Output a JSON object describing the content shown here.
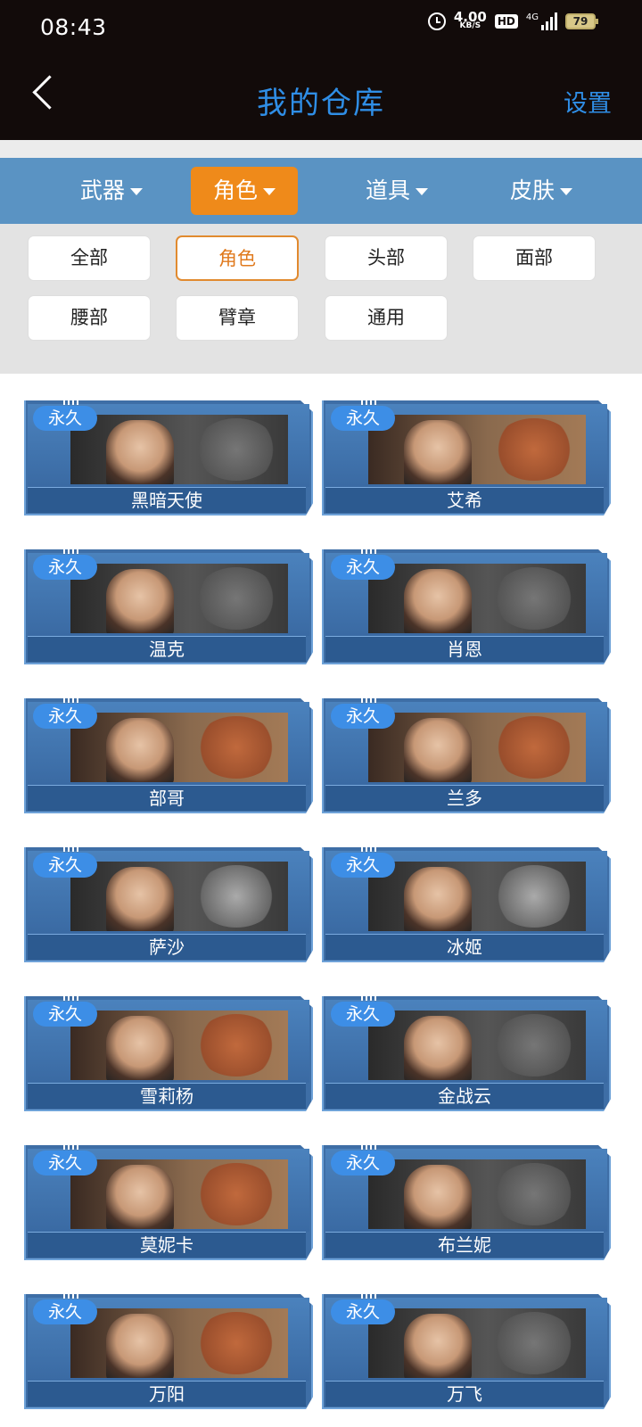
{
  "status_bar": {
    "time": "08:43",
    "net_speed": "4.00",
    "net_unit": "KB/S",
    "hd": "HD",
    "signal_label": "4G",
    "battery": "79"
  },
  "header": {
    "title": "我的仓库",
    "settings_label": "设置"
  },
  "categories": [
    {
      "label": "武器",
      "active": false
    },
    {
      "label": "角色",
      "active": true
    },
    {
      "label": "道具",
      "active": false
    },
    {
      "label": "皮肤",
      "active": false
    }
  ],
  "filters": [
    {
      "label": "全部",
      "active": false
    },
    {
      "label": "角色",
      "active": true
    },
    {
      "label": "头部",
      "active": false
    },
    {
      "label": "面部",
      "active": false
    },
    {
      "label": "腰部",
      "active": false
    },
    {
      "label": "臂章",
      "active": false
    },
    {
      "label": "通用",
      "active": false
    }
  ],
  "items": [
    {
      "badge": "永久",
      "name": "黑暗天使",
      "emblem": "wings-emblem"
    },
    {
      "badge": "永久",
      "name": "艾希",
      "emblem": "fist-emblem"
    },
    {
      "badge": "永久",
      "name": "温克",
      "emblem": "wings-emblem"
    },
    {
      "badge": "永久",
      "name": "肖恩",
      "emblem": "wings-emblem"
    },
    {
      "badge": "永久",
      "name": "部哥",
      "emblem": "fist-emblem"
    },
    {
      "badge": "永久",
      "name": "兰多",
      "emblem": "fist-emblem"
    },
    {
      "badge": "永久",
      "name": "萨沙",
      "emblem": "star-emblem"
    },
    {
      "badge": "永久",
      "name": "冰姬",
      "emblem": "star-emblem"
    },
    {
      "badge": "永久",
      "name": "雪莉杨",
      "emblem": "fist-emblem"
    },
    {
      "badge": "永久",
      "name": "金战云",
      "emblem": "wings-emblem"
    },
    {
      "badge": "永久",
      "name": "莫妮卡",
      "emblem": "fist-emblem"
    },
    {
      "badge": "永久",
      "name": "布兰妮",
      "emblem": "wings-emblem"
    },
    {
      "badge": "永久",
      "name": "万阳",
      "emblem": "fist-emblem"
    },
    {
      "badge": "永久",
      "name": "万飞",
      "emblem": "wings-emblem"
    }
  ]
}
